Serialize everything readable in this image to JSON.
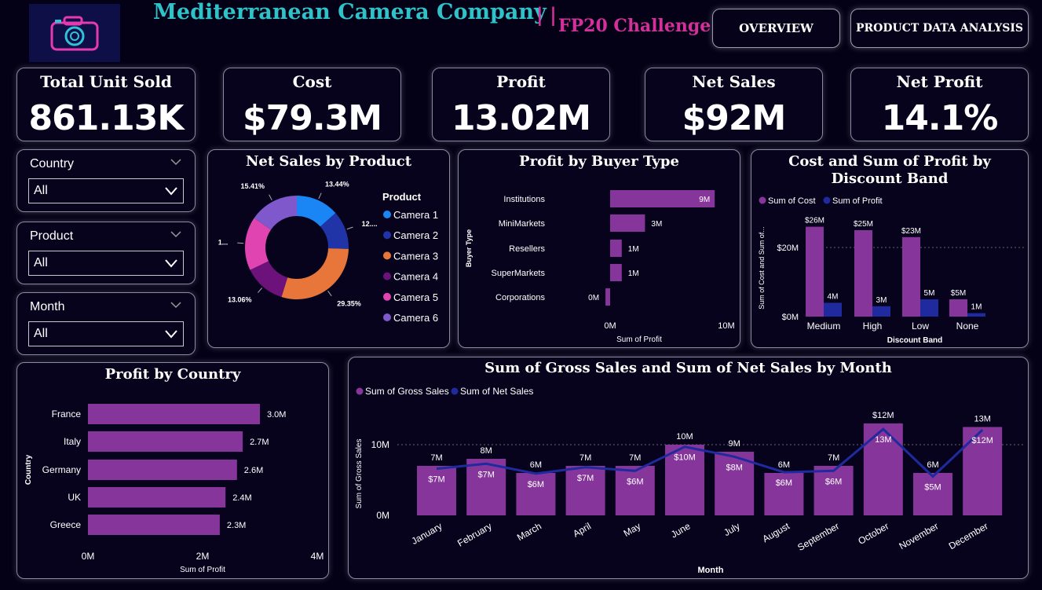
{
  "header": {
    "title": "Mediterranean Camera Company",
    "separator": "| |",
    "subtitle": "FP20 Challenge",
    "nav": [
      {
        "label": "OVERVIEW"
      },
      {
        "label": "PRODUCT DATA ANALYSIS"
      }
    ]
  },
  "kpis": [
    {
      "title": "Total Unit Sold",
      "value": "861.13K"
    },
    {
      "title": "Cost",
      "value": "$79.3M"
    },
    {
      "title": "Profit",
      "value": "13.02M"
    },
    {
      "title": "Net Sales",
      "value": "$92M"
    },
    {
      "title": "Net Profit",
      "value": "14.1%"
    }
  ],
  "slicers": [
    {
      "label": "Country",
      "value": "All"
    },
    {
      "label": "Product",
      "value": "All"
    },
    {
      "label": "Month",
      "value": "All"
    }
  ],
  "colors": {
    "background": "#040116",
    "purple_bar": "#86369a",
    "navy": "#1f2a9e",
    "title_teal": "#2fc2c9",
    "title_pink": "#d42f9a"
  },
  "chart_data": [
    {
      "id": "net-sales-by-product",
      "type": "pie",
      "title": "Net Sales by Product",
      "legend_title": "Product",
      "legend_position": "right",
      "categories": [
        "Camera 1",
        "Camera 2",
        "Camera 3",
        "Camera 4",
        "Camera 5",
        "Camera 6"
      ],
      "values": [
        13.44,
        12.0,
        29.35,
        13.06,
        16.74,
        15.41
      ],
      "labels": [
        "13.44%",
        "12....",
        "29.35%",
        "13.06%",
        "1...",
        "15.41%"
      ],
      "colors": [
        "#1a86f5",
        "#2034a8",
        "#e8763a",
        "#6c127a",
        "#e044b0",
        "#7f58cc"
      ]
    },
    {
      "id": "profit-by-buyer-type",
      "type": "bar",
      "orientation": "horizontal",
      "title": "Profit by Buyer Type",
      "xlabel": "Sum of Profit",
      "ylabel": "Buyer Type",
      "categories": [
        "Institutions",
        "MiniMarkets",
        "Resellers",
        "SuperMarkets",
        "Corporations"
      ],
      "values": [
        9,
        3,
        1,
        1,
        -0.4
      ],
      "data_labels": [
        "9M",
        "3M",
        "1M",
        "1M",
        "0M"
      ],
      "xlim": [
        -1.2,
        10
      ],
      "xticks": [
        {
          "v": 0,
          "label": "0M"
        },
        {
          "v": 10,
          "label": "10M"
        }
      ]
    },
    {
      "id": "cost-profit-by-discount",
      "type": "bar",
      "title": "Cost and Sum of Profit by Discount Band",
      "xlabel": "Discount Band",
      "ylabel": "Sum of Cost and Sum of...",
      "legend_position": "top-left",
      "categories": [
        "Medium",
        "High",
        "Low",
        "None"
      ],
      "series": [
        {
          "name": "Sum of Cost",
          "values": [
            26,
            25,
            23,
            5
          ],
          "labels": [
            "$26M",
            "$25M",
            "$23M",
            "$5M"
          ],
          "color": "#86369a"
        },
        {
          "name": "Sum of Profit",
          "values": [
            4,
            3,
            5,
            1
          ],
          "labels": [
            "4M",
            "3M",
            "5M",
            "1M"
          ],
          "color": "#1f2a9e"
        }
      ],
      "ylim": [
        0,
        30
      ],
      "yticks": [
        {
          "v": 0,
          "label": "$0M"
        },
        {
          "v": 20,
          "label": "$20M"
        }
      ]
    },
    {
      "id": "profit-by-country",
      "type": "bar",
      "orientation": "horizontal",
      "title": "Profit by Country",
      "xlabel": "Sum of Profit",
      "ylabel": "Country",
      "categories": [
        "France",
        "Italy",
        "Germany",
        "UK",
        "Greece"
      ],
      "values": [
        3.0,
        2.7,
        2.6,
        2.4,
        2.3
      ],
      "data_labels": [
        "3.0M",
        "2.7M",
        "2.6M",
        "2.4M",
        "2.3M"
      ],
      "xlim": [
        0,
        4
      ],
      "xticks": [
        {
          "v": 0,
          "label": "0M"
        },
        {
          "v": 2,
          "label": "2M"
        },
        {
          "v": 4,
          "label": "4M"
        }
      ]
    },
    {
      "id": "gross-net-sales-by-month",
      "type": "bar",
      "title": "Sum of Gross Sales and Sum of Net Sales by Month",
      "xlabel": "Month",
      "ylabel": "Sum of Gross Sales",
      "legend_position": "top-left",
      "categories": [
        "January",
        "February",
        "March",
        "April",
        "May",
        "June",
        "July",
        "August",
        "September",
        "October",
        "November",
        "December"
      ],
      "series": [
        {
          "name": "Sum of Gross Sales",
          "kind": "bar",
          "values": [
            7,
            8,
            6,
            7,
            7,
            10,
            9,
            6,
            7,
            13,
            6,
            12.5
          ],
          "labels": [
            "7M",
            "8M",
            "6M",
            "7M",
            "7M",
            "10M",
            "9M",
            "6M",
            "7M",
            "$12M",
            "6M",
            "13M"
          ],
          "color": "#86369a"
        },
        {
          "name": "Sum of Net Sales",
          "kind": "line",
          "values": [
            6.6,
            7.3,
            5.9,
            6.8,
            6.3,
            9.7,
            8.3,
            6.1,
            6.3,
            12.2,
            5.5,
            12.1
          ],
          "labels": [
            "$7M",
            "$7M",
            "$6M",
            "$7M",
            "$6M",
            "$10M",
            "$8M",
            "$6M",
            "$6M",
            "13M",
            "$5M",
            "$12M"
          ],
          "color": "#1f2a9e"
        }
      ],
      "ylim": [
        0,
        14
      ],
      "yticks": [
        {
          "v": 0,
          "label": "0M"
        },
        {
          "v": 10,
          "label": "10M"
        }
      ]
    }
  ]
}
